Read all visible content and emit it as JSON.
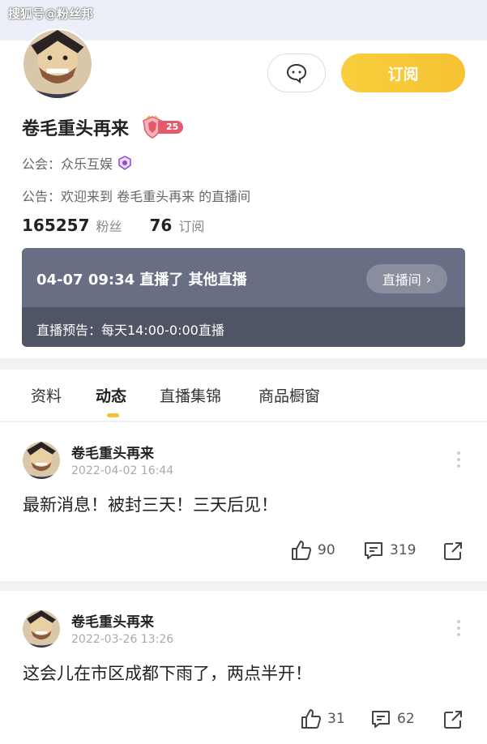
{
  "watermark": "搜狐号@粉丝邦",
  "profile": {
    "name": "卷毛重头再来",
    "level": "25",
    "guild_label": "公会：众乐互娱",
    "notice": "公告：欢迎来到 卷毛重头再来 的直播间",
    "fans_count": "165257",
    "fans_label": "粉丝",
    "sub_count": "76",
    "sub_label": "订阅",
    "subscribe_btn": "订阅"
  },
  "live": {
    "title": "04-07 09:34 直播了 其他直播",
    "room_btn": "直播间",
    "schedule": "直播预告：每天14:00-0:00直播"
  },
  "tabs": [
    {
      "label": "资料"
    },
    {
      "label": "动态"
    },
    {
      "label": "直播集锦"
    },
    {
      "label": "商品橱窗"
    }
  ],
  "posts": [
    {
      "author": "卷毛重头再来",
      "date": "2022-04-02 16:44",
      "text": "最新消息！被封三天！三天后见！",
      "likes": "90",
      "comments": "319"
    },
    {
      "author": "卷毛重头再来",
      "date": "2022-03-26 13:26",
      "text": "这会儿在市区成都下雨了，两点半开！",
      "likes": "31",
      "comments": "62"
    }
  ],
  "icons": {
    "message": "chat-bubble-icon",
    "guild": "guild-badge-icon",
    "like": "thumbs-up-icon",
    "comment": "comment-icon",
    "share": "share-icon",
    "more": "more-vertical-icon"
  },
  "colors": {
    "accent": "#f6c133",
    "live_top": "#686f84",
    "live_bottom": "#4f5564",
    "level_badge": "#e35a6b"
  }
}
